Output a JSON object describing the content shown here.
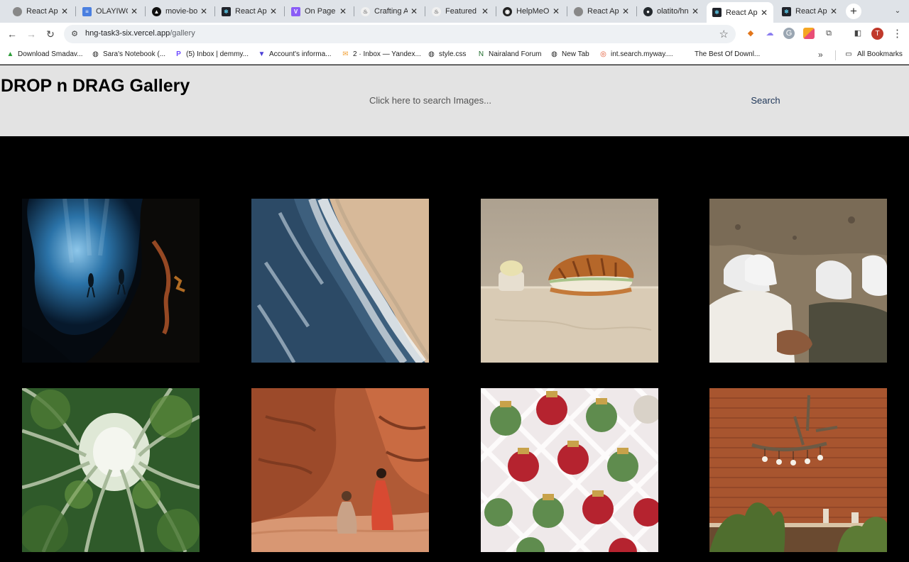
{
  "browser": {
    "tabs": [
      {
        "title": "React App",
        "icon": "globe-icon"
      },
      {
        "title": "OLAYIWO",
        "icon": "docs-icon"
      },
      {
        "title": "movie-bo",
        "icon": "vercel-icon"
      },
      {
        "title": "React App",
        "icon": "react-icon"
      },
      {
        "title": "On Page A",
        "icon": "vite-icon"
      },
      {
        "title": "Crafting A",
        "icon": "flame-icon"
      },
      {
        "title": "Featured",
        "icon": "flame-icon"
      },
      {
        "title": "HelpMeOu",
        "icon": "helpme-icon"
      },
      {
        "title": "React App",
        "icon": "globe-icon"
      },
      {
        "title": "olatito/hn",
        "icon": "github-icon"
      },
      {
        "title": "React App",
        "icon": "react-icon",
        "active": true
      },
      {
        "title": "React App",
        "icon": "react-icon"
      }
    ],
    "url": {
      "host": "hng-task3-six.vercel.app",
      "path": "/gallery"
    },
    "profile_initial": "T",
    "bookmarks": [
      {
        "label": "Download Smadav...",
        "icon": "smadav-icon"
      },
      {
        "label": "Sara's Notebook (...",
        "icon": "globe-icon"
      },
      {
        "label": "(5) Inbox | demmy...",
        "icon": "proton-icon"
      },
      {
        "label": "Account's informa...",
        "icon": "vpn-icon"
      },
      {
        "label": "2 · Inbox — Yandex...",
        "icon": "mail-icon"
      },
      {
        "label": "style.css",
        "icon": "globe-icon"
      },
      {
        "label": "Nairaland Forum",
        "icon": "nairaland-icon"
      },
      {
        "label": "New Tab",
        "icon": "globe-icon"
      },
      {
        "label": "int.search.myway....",
        "icon": "myway-icon"
      },
      {
        "label": "The Best Of Downl...",
        "icon": "none"
      }
    ],
    "all_bookmarks_label": "All Bookmarks"
  },
  "page": {
    "title": "DROP n DRAG Gallery",
    "search": {
      "placeholder": "Click here to search Images...",
      "value": "",
      "button_label": "Search"
    },
    "gallery": [
      {
        "subject": "divers-underwater-cave"
      },
      {
        "subject": "ocean-waves-beach"
      },
      {
        "subject": "croissant-sandwich-table"
      },
      {
        "subject": "white-sneakers-sand"
      },
      {
        "subject": "bamboo-forest-canopy"
      },
      {
        "subject": "red-rock-canyon-women"
      },
      {
        "subject": "christmas-ornaments-box"
      },
      {
        "subject": "brick-wall-chandelier"
      }
    ]
  },
  "colors": {
    "tabstrip": "#dfe3e8",
    "header_bg": "#e3e3e3",
    "gallery_bg": "#000000",
    "search_button": "#1d3557"
  }
}
